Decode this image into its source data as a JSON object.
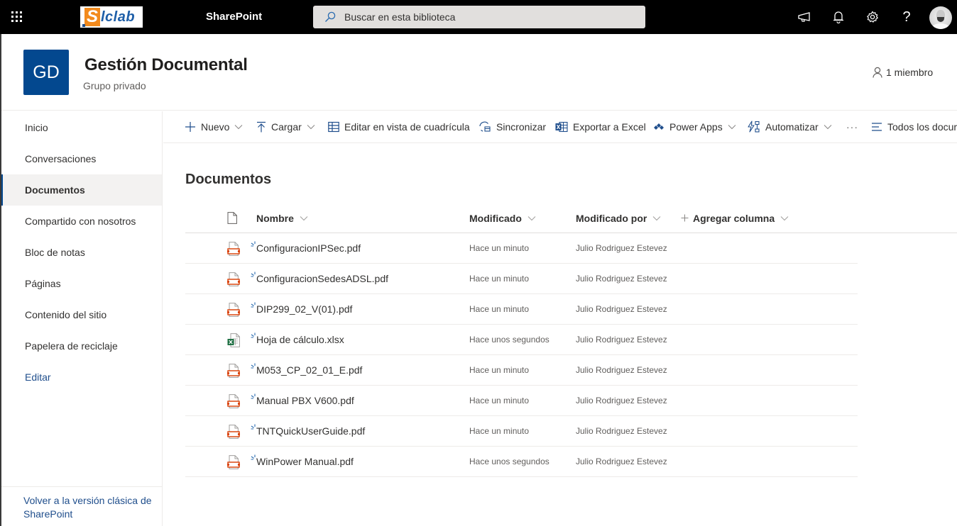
{
  "suitebar": {
    "app_name": "SharePoint",
    "logo_letter": "S",
    "logo_text": "lclab",
    "search_placeholder": "Buscar en esta biblioteca",
    "icons": [
      "waffle-icon",
      "megaphone-icon",
      "bell-icon",
      "gear-icon",
      "help-icon",
      "avatar"
    ]
  },
  "site": {
    "initials": "GD",
    "title": "Gestión Documental",
    "subtitle": "Grupo privado",
    "members": "1 miembro",
    "accent_color": "#03488f"
  },
  "leftnav": {
    "items": [
      {
        "label": "Inicio",
        "active": false
      },
      {
        "label": "Conversaciones",
        "active": false
      },
      {
        "label": "Documentos",
        "active": true
      },
      {
        "label": "Compartido con nosotros",
        "active": false
      },
      {
        "label": "Bloc de notas",
        "active": false
      },
      {
        "label": "Páginas",
        "active": false
      },
      {
        "label": "Contenido del sitio",
        "active": false
      },
      {
        "label": "Papelera de reciclaje",
        "active": false
      },
      {
        "label": "Editar",
        "active": false
      }
    ],
    "classic_link": "Volver a la versión clásica de SharePoint"
  },
  "commandbar": {
    "new": "Nuevo",
    "upload": "Cargar",
    "grid_edit": "Editar en vista de cuadrícula",
    "sync": "Sincronizar",
    "export": "Exportar a Excel",
    "powerapps": "Power Apps",
    "automate": "Automatizar",
    "more": "···",
    "view": "Todos los docur"
  },
  "library": {
    "title": "Documentos",
    "columns": {
      "name": "Nombre",
      "modified": "Modificado",
      "modified_by": "Modificado por",
      "add_column": "Agregar columna"
    },
    "files": [
      {
        "name": "ConfiguracionIPSec.pdf",
        "type": "pdf",
        "modified": "Hace un minuto",
        "modified_by": "Julio Rodriguez Estevez"
      },
      {
        "name": "ConfiguracionSedesADSL.pdf",
        "type": "pdf",
        "modified": "Hace un minuto",
        "modified_by": "Julio Rodriguez Estevez"
      },
      {
        "name": "DIP299_02_V(01).pdf",
        "type": "pdf",
        "modified": "Hace un minuto",
        "modified_by": "Julio Rodriguez Estevez"
      },
      {
        "name": "Hoja de cálculo.xlsx",
        "type": "xlsx",
        "modified": "Hace unos segundos",
        "modified_by": "Julio Rodriguez Estevez"
      },
      {
        "name": "M053_CP_02_01_E.pdf",
        "type": "pdf",
        "modified": "Hace un minuto",
        "modified_by": "Julio Rodriguez Estevez"
      },
      {
        "name": "Manual PBX V600.pdf",
        "type": "pdf",
        "modified": "Hace un minuto",
        "modified_by": "Julio Rodriguez Estevez"
      },
      {
        "name": "TNTQuickUserGuide.pdf",
        "type": "pdf",
        "modified": "Hace un minuto",
        "modified_by": "Julio Rodriguez Estevez"
      },
      {
        "name": "WinPower Manual.pdf",
        "type": "pdf",
        "modified": "Hace unos segundos",
        "modified_by": "Julio Rodriguez Estevez"
      }
    ]
  }
}
